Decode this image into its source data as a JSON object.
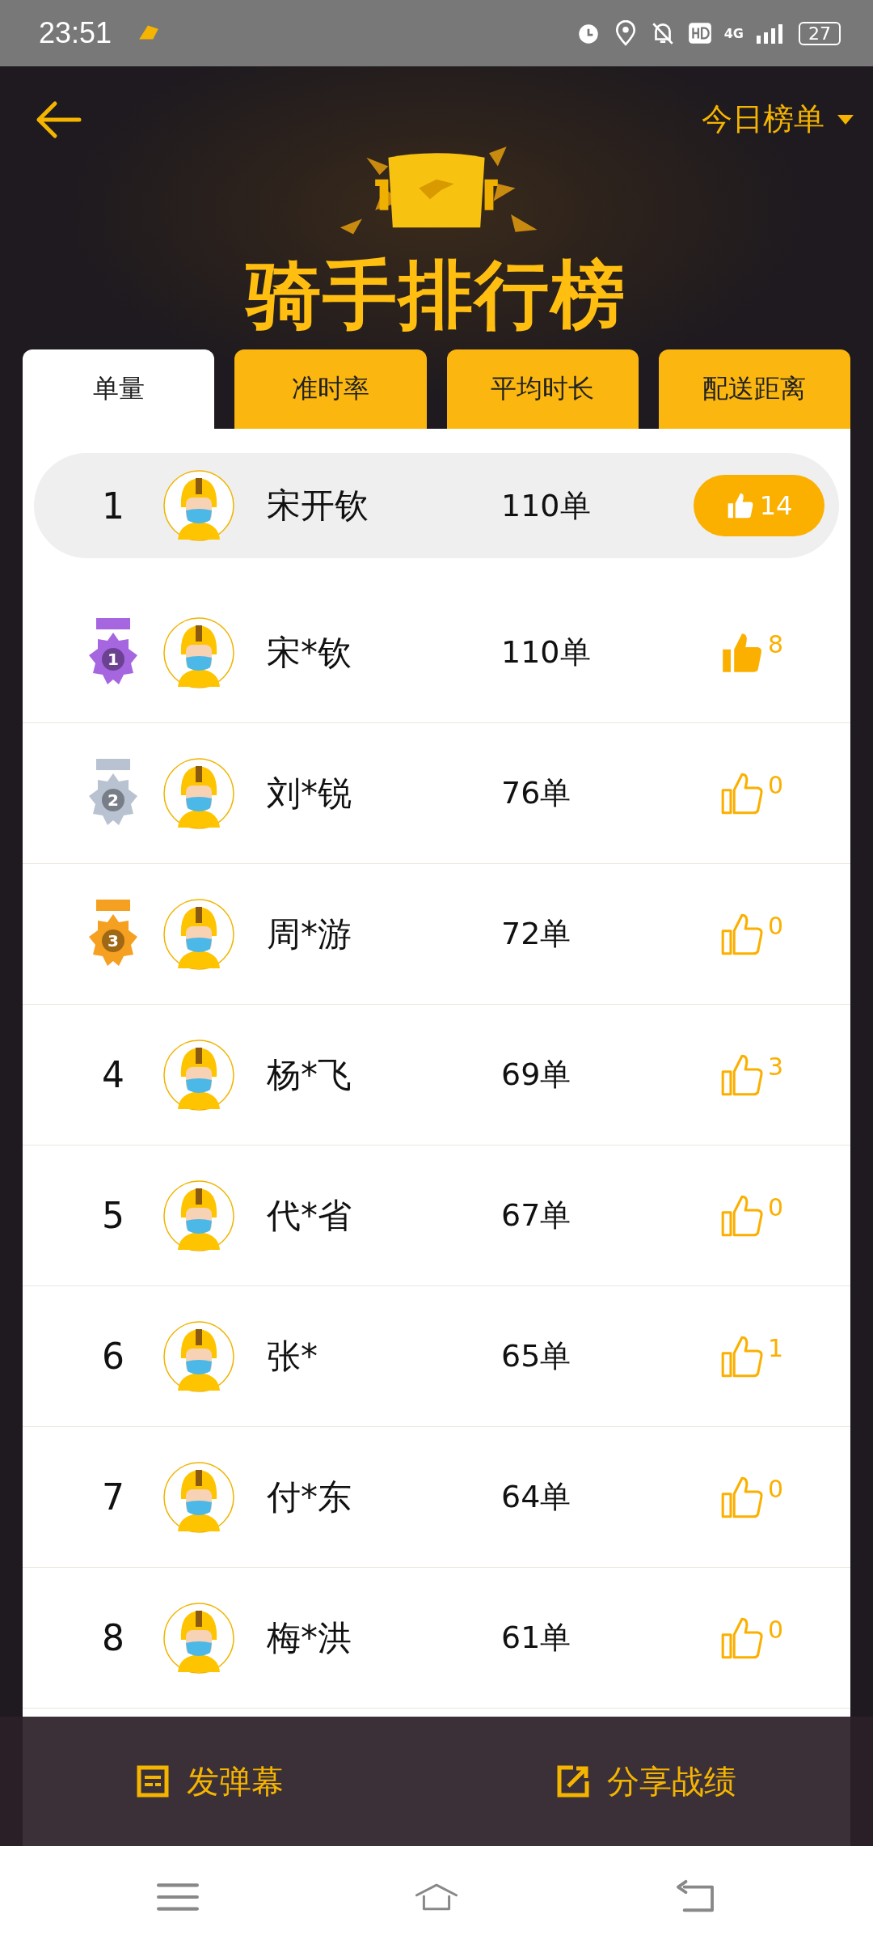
{
  "status_bar": {
    "time": "23:51",
    "network": "4G",
    "battery": "27"
  },
  "header": {
    "title": "骑手排行榜",
    "period": "今日榜单"
  },
  "tabs": [
    {
      "label": "单量",
      "selected": true
    },
    {
      "label": "准时率",
      "selected": false
    },
    {
      "label": "平均时长",
      "selected": false
    },
    {
      "label": "配送距离",
      "selected": false
    }
  ],
  "my_rank": {
    "rank": "1",
    "name": "宋开钦",
    "orders": "110单",
    "likes": "14"
  },
  "rows": [
    {
      "kind": "medal",
      "rank": "1",
      "color": "#a566e0",
      "name": "宋*钦",
      "orders": "110单",
      "likes": "8",
      "liked": true
    },
    {
      "kind": "medal",
      "rank": "2",
      "color": "#b9c2d0",
      "name": "刘*锐",
      "orders": "76单",
      "likes": "0",
      "liked": false
    },
    {
      "kind": "medal",
      "rank": "3",
      "color": "#f5a020",
      "name": "周*游",
      "orders": "72单",
      "likes": "0",
      "liked": false
    },
    {
      "kind": "number",
      "rank": "4",
      "name": "杨*飞",
      "orders": "69单",
      "likes": "3",
      "liked": false
    },
    {
      "kind": "number",
      "rank": "5",
      "name": "代*省",
      "orders": "67单",
      "likes": "0",
      "liked": false
    },
    {
      "kind": "number",
      "rank": "6",
      "name": "张*",
      "orders": "65单",
      "likes": "1",
      "liked": false
    },
    {
      "kind": "number",
      "rank": "7",
      "name": "付*东",
      "orders": "64单",
      "likes": "0",
      "liked": false
    },
    {
      "kind": "number",
      "rank": "8",
      "name": "梅*洪",
      "orders": "61单",
      "likes": "0",
      "liked": false
    }
  ],
  "bottom_bar": {
    "danmaku": "发弹幕",
    "share": "分享战绩"
  }
}
